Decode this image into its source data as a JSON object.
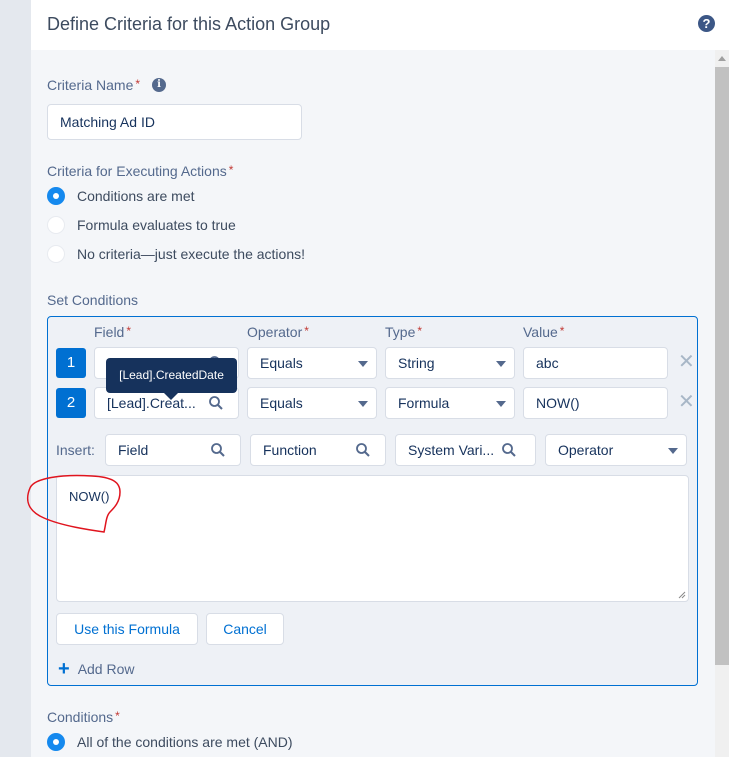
{
  "header": {
    "title": "Define Criteria for this Action Group",
    "help_icon": "question-circle-icon"
  },
  "criteria_name": {
    "label": "Criteria Name",
    "required_mark": "*",
    "info_icon": "info-icon",
    "value": "Matching Ad ID"
  },
  "criteria_for_executing": {
    "label": "Criteria for Executing Actions",
    "required_mark": "*",
    "options": [
      {
        "label": "Conditions are met",
        "checked": true
      },
      {
        "label": "Formula evaluates to true",
        "checked": false
      },
      {
        "label": "No criteria—just execute the actions!",
        "checked": false
      }
    ]
  },
  "set_conditions": {
    "label": "Set Conditions",
    "columns": {
      "field": "Field",
      "operator": "Operator",
      "type": "Type",
      "value": "Value",
      "required_mark": "*"
    },
    "rows": [
      {
        "number": "1",
        "field": "",
        "operator": "Equals",
        "type": "String",
        "value": "abc"
      },
      {
        "number": "2",
        "field": "[Lead].Creat...",
        "operator": "Equals",
        "type": "Formula",
        "value": "NOW()"
      }
    ],
    "tooltip": "[Lead].CreatedDate",
    "insert": {
      "label": "Insert:",
      "field": "Field",
      "function": "Function",
      "system_variable": "System Vari...",
      "operator": "Operator"
    },
    "formula_text": "NOW()",
    "use_formula_button": "Use this Formula",
    "cancel_button": "Cancel",
    "add_row": "Add Row"
  },
  "conditions": {
    "label": "Conditions",
    "required_mark": "*",
    "options": [
      {
        "label": "All of the conditions are met (AND)",
        "checked": true
      }
    ]
  },
  "colors": {
    "accent": "#0070d2",
    "radio_checked": "#1589ee",
    "tooltip_bg": "#16325c",
    "required": "#c23934",
    "annotation": "#e0141e"
  }
}
